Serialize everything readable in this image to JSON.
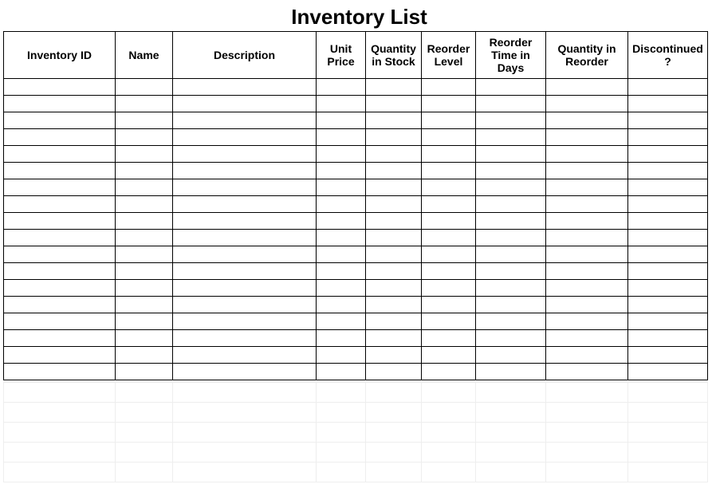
{
  "title": "Inventory List",
  "columns": [
    "Inventory ID",
    "Name",
    "Description",
    "Unit Price",
    "Quantity in Stock",
    "Reorder Level",
    "Reorder Time in Days",
    "Quantity in Reorder",
    "Discontinued?"
  ],
  "data_row_count": 18,
  "faint_row_count": 5
}
